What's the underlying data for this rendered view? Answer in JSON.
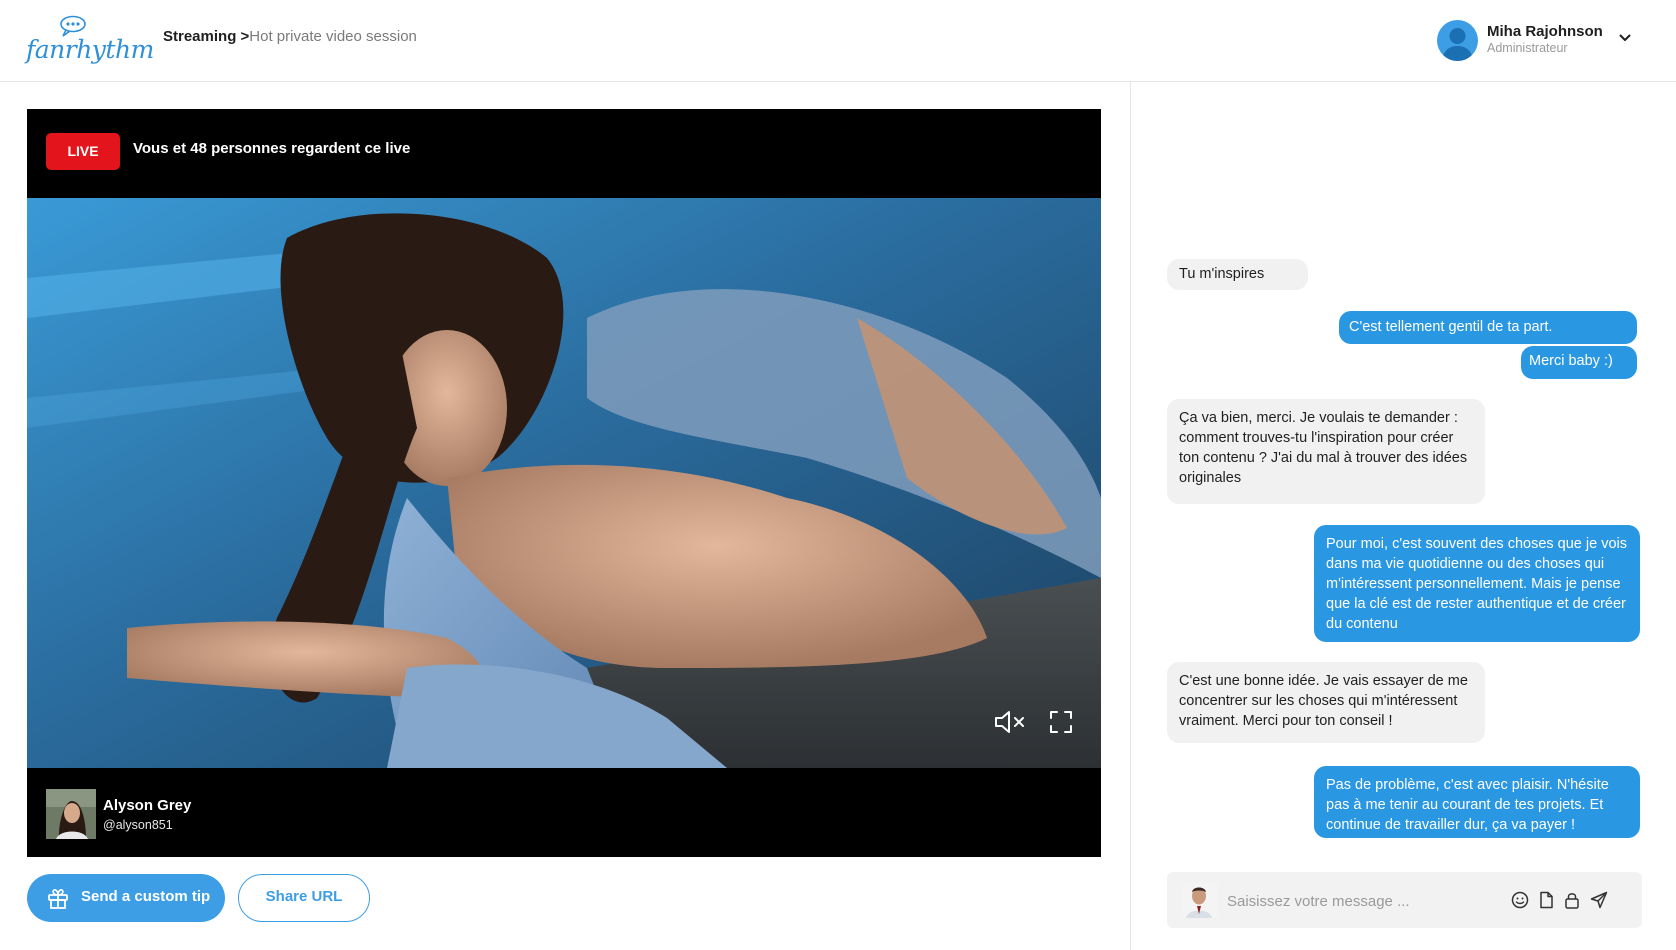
{
  "header": {
    "logo_text": "fanrhythm",
    "breadcrumb": {
      "main": "Streaming",
      "separator": ">",
      "current": "Hot private video session"
    },
    "user": {
      "name": "Miha Rajohnson",
      "role": "Administrateur"
    }
  },
  "video": {
    "live_label": "LIVE",
    "viewers_text": "Vous et 48 personnes regardent ce live",
    "streamer": {
      "name": "Alyson Grey",
      "handle": "@alyson851"
    },
    "controls": {
      "muted": true
    }
  },
  "actions": {
    "tip_label": "Send a custom tip",
    "share_label": "Share URL"
  },
  "chat": {
    "messages": [
      {
        "from": "viewer",
        "text": "Tu m'inspires"
      },
      {
        "from": "me",
        "text": "C'est tellement gentil de ta part."
      },
      {
        "from": "me",
        "text": "Merci baby :)"
      },
      {
        "from": "viewer",
        "text": "Ça va bien, merci. Je voulais te demander : comment trouves-tu l'inspiration pour créer ton contenu ? J'ai du mal à trouver des idées originales"
      },
      {
        "from": "me",
        "text": "Pour moi, c'est souvent des choses que je vois dans ma vie quotidienne ou des choses qui m'intéressent personnellement. Mais je pense que la clé est de rester authentique et de créer du contenu"
      },
      {
        "from": "viewer",
        "text": "C'est une bonne idée. Je vais essayer de me concentrer sur les choses qui m'intéressent vraiment. Merci pour ton conseil !"
      },
      {
        "from": "me",
        "text": "Pas de problème, c'est avec plaisir. N'hésite pas à me tenir au courant de tes projets. Et continue de travailler dur, ça va payer !"
      }
    ],
    "composer": {
      "placeholder": "Saisissez votre message ...",
      "value": ""
    }
  },
  "colors": {
    "accent": "#2a97e3",
    "live": "#e3141b",
    "incoming_bg": "#f1f1f1"
  }
}
